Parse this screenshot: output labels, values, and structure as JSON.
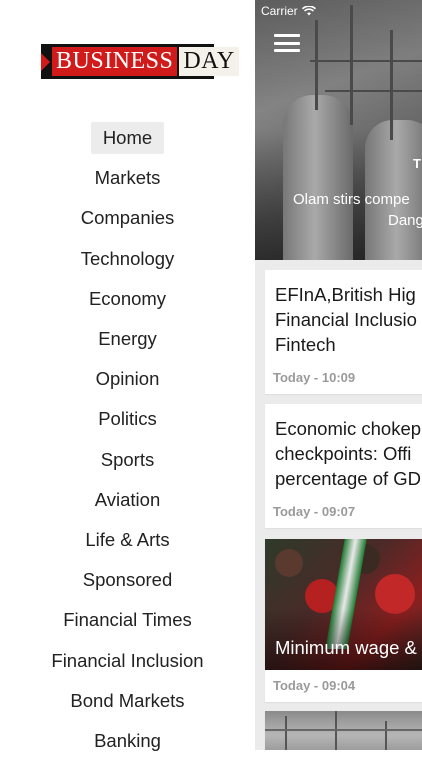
{
  "logo": {
    "business": "BUSINESS",
    "day": "DAY"
  },
  "menu": {
    "items": [
      {
        "label": "Home",
        "active": true
      },
      {
        "label": "Markets"
      },
      {
        "label": "Companies"
      },
      {
        "label": "Technology"
      },
      {
        "label": "Economy"
      },
      {
        "label": "Energy"
      },
      {
        "label": "Opinion"
      },
      {
        "label": "Politics"
      },
      {
        "label": "Sports"
      },
      {
        "label": "Aviation"
      },
      {
        "label": "Life & Arts"
      },
      {
        "label": "Sponsored"
      },
      {
        "label": "Financial Times"
      },
      {
        "label": "Financial Inclusion"
      },
      {
        "label": "Bond Markets"
      },
      {
        "label": "Banking"
      }
    ]
  },
  "status_bar": {
    "carrier": "Carrier"
  },
  "hero": {
    "tag": "T",
    "title_line1": "Olam stirs compe",
    "title_line2": "Dang"
  },
  "articles": [
    {
      "title_line1": "EFInA,British Hig",
      "title_line2": "Financial Inclusio",
      "title_line3": "Fintech",
      "time": "Today - 10:09"
    },
    {
      "title_line1": "Economic chokep",
      "title_line2": "checkpoints: Offi",
      "title_line3": "percentage of GD",
      "time": "Today - 09:07"
    },
    {
      "image_caption": "Minimum wage &",
      "time": "Today - 09:04"
    }
  ],
  "colors": {
    "brand_red": "#d11a1a",
    "active_bg": "#ececec",
    "time_gray": "#9a9a9a"
  }
}
